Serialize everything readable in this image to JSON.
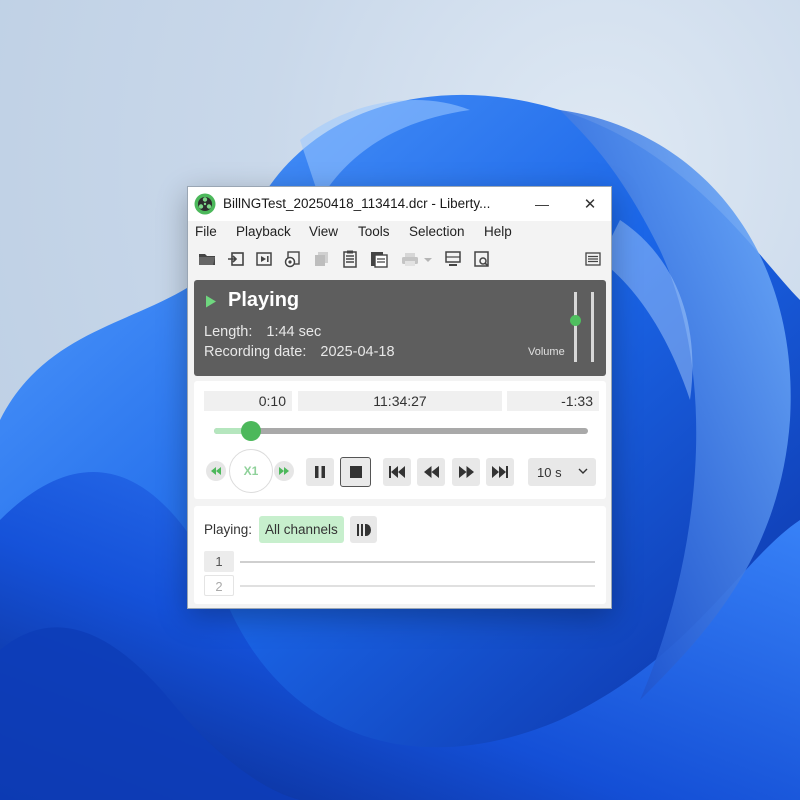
{
  "window": {
    "title": "BillNGTest_20250418_113414.dcr - Liberty...",
    "minimize_glyph": "—",
    "close_glyph": "✕"
  },
  "menu": [
    "File",
    "Playback",
    "View",
    "Tools",
    "Selection",
    "Help"
  ],
  "toolbar": {
    "icons": [
      "open-folder-icon",
      "import-icon",
      "play-to-end-icon",
      "record-icon",
      "copy-icon",
      "notes-icon",
      "files-icon",
      "print-icon",
      "dropdown-icon",
      "monitor-icon",
      "search-document-icon",
      "hamburger-menu-icon"
    ]
  },
  "status": {
    "state": "Playing",
    "length_label": "Length:",
    "length_value": "1:44 sec",
    "date_label": "Recording date:",
    "date_value": "2025-04-18",
    "volume_label": "Volume",
    "volume_level": 0.6
  },
  "seek": {
    "elapsed": "0:10",
    "clock": "11:34:27",
    "remaining": "-1:33",
    "progress": 0.1
  },
  "transport": {
    "speed": "X1",
    "step_value": "10 s"
  },
  "channels": {
    "playing_label": "Playing:",
    "selection": "All channels",
    "items": [
      "1",
      "2"
    ]
  },
  "colors": {
    "accent_green": "#4cb85b",
    "status_panel": "#5e5e5e",
    "selected_green": "#c7efcd"
  }
}
